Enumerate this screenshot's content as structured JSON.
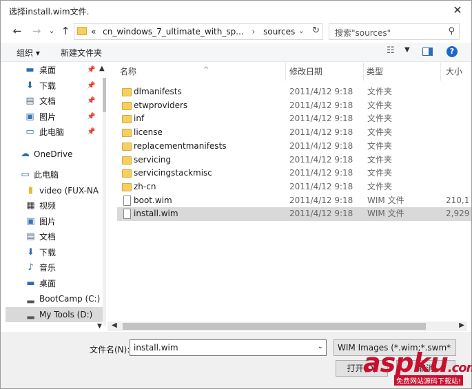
{
  "window": {
    "title": "选择install.wim文件.",
    "close_glyph": "✕"
  },
  "address": {
    "back_glyph": "←",
    "forward_glyph": "→",
    "recent_glyph": "⌄",
    "up_glyph": "↑",
    "crumb_overflow": "«",
    "crumbs": [
      "cn_windows_7_ultimate_with_sp...",
      "sources"
    ],
    "crumb_separator": "›",
    "refresh_glyph": "↻"
  },
  "search": {
    "placeholder": "搜索\"sources\"",
    "icon": "search-icon"
  },
  "toolbar": {
    "organize_label": "组织 ▾",
    "new_folder_label": "新建文件夹",
    "help_label": "?"
  },
  "nav": {
    "quick_access": [
      {
        "label": "桌面",
        "icon": "desktop-icon"
      },
      {
        "label": "下载",
        "icon": "download-icon"
      },
      {
        "label": "文档",
        "icon": "document-icon"
      },
      {
        "label": "图片",
        "icon": "pictures-icon"
      },
      {
        "label": "此电脑",
        "icon": "computer-icon"
      }
    ],
    "onedrive": "OneDrive",
    "this_pc": "此电脑",
    "pc_items": [
      {
        "label": "video (FUX-NA",
        "icon": "usb-drive-icon"
      },
      {
        "label": "视频",
        "icon": "video-icon"
      },
      {
        "label": "图片",
        "icon": "pictures-icon"
      },
      {
        "label": "文档",
        "icon": "document-icon"
      },
      {
        "label": "下载",
        "icon": "download-icon"
      },
      {
        "label": "音乐",
        "icon": "music-icon"
      },
      {
        "label": "桌面",
        "icon": "desktop-icon"
      },
      {
        "label": "BootCamp (C:)",
        "icon": "drive-icon"
      },
      {
        "label": "My Tools (D:)",
        "icon": "drive-icon",
        "selected": true
      }
    ]
  },
  "columns": {
    "name": "名称",
    "modified": "修改日期",
    "type": "类型",
    "size": "大小"
  },
  "files": [
    {
      "name": "dlmanifests",
      "modified": "2011/4/12 9:18",
      "type": "文件夹",
      "size": "",
      "kind": "folder"
    },
    {
      "name": "etwproviders",
      "modified": "2011/4/12 9:18",
      "type": "文件夹",
      "size": "",
      "kind": "folder"
    },
    {
      "name": "inf",
      "modified": "2011/4/12 9:18",
      "type": "文件夹",
      "size": "",
      "kind": "folder"
    },
    {
      "name": "license",
      "modified": "2011/4/12 9:18",
      "type": "文件夹",
      "size": "",
      "kind": "folder"
    },
    {
      "name": "replacementmanifests",
      "modified": "2011/4/12 9:18",
      "type": "文件夹",
      "size": "",
      "kind": "folder"
    },
    {
      "name": "servicing",
      "modified": "2011/4/12 9:18",
      "type": "文件夹",
      "size": "",
      "kind": "folder"
    },
    {
      "name": "servicingstackmisc",
      "modified": "2011/4/12 9:18",
      "type": "文件夹",
      "size": "",
      "kind": "folder"
    },
    {
      "name": "zh-cn",
      "modified": "2011/4/12 9:18",
      "type": "文件夹",
      "size": "",
      "kind": "folder"
    },
    {
      "name": "boot.wim",
      "modified": "2011/4/12 9:18",
      "type": "WIM 文件",
      "size": "210,1",
      "kind": "file"
    },
    {
      "name": "install.wim",
      "modified": "2011/4/12 9:18",
      "type": "WIM 文件",
      "size": "2,929",
      "kind": "file",
      "selected": true
    }
  ],
  "bottom": {
    "filename_label": "文件名(N):",
    "filename_value": "install.wim",
    "filetype_value": "WIM Images (*.wim;*.swm*",
    "open_label": "打开(O)",
    "cancel_label": "取消"
  },
  "watermark": {
    "main": "aspku",
    "tld": ".com",
    "sub": "免费网站源码下载站!"
  }
}
